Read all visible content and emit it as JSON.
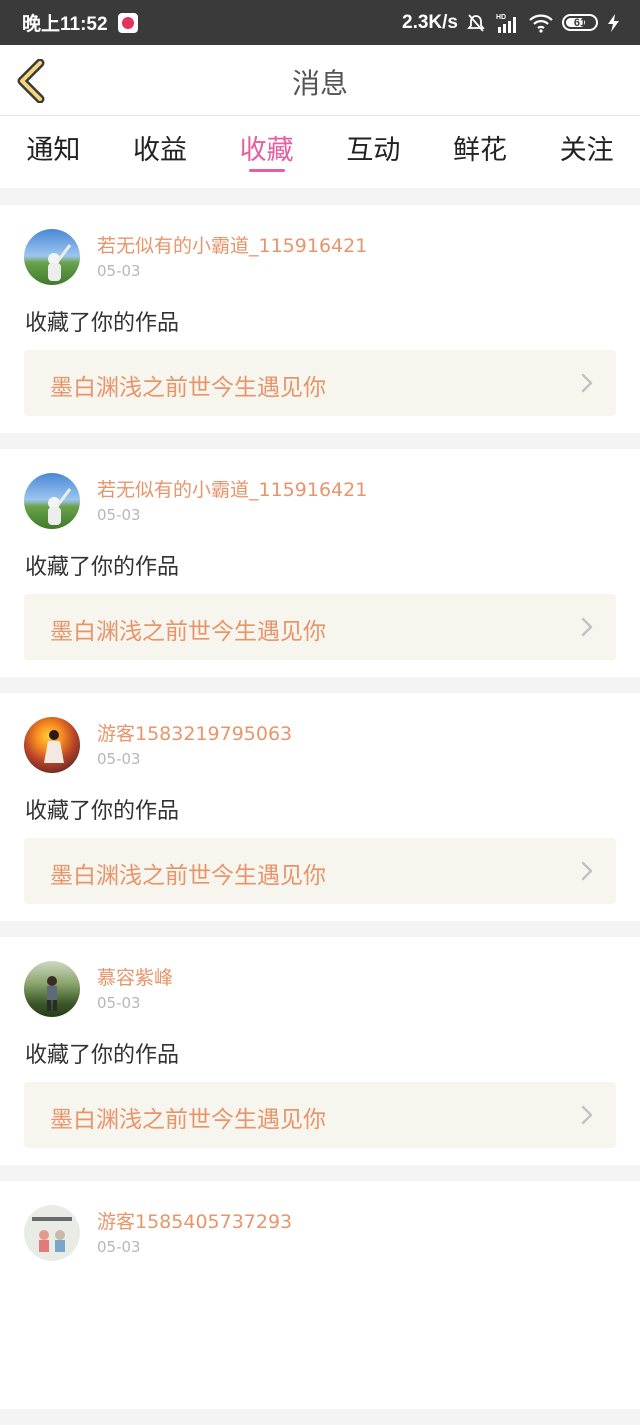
{
  "status": {
    "time": "晚上11:52",
    "speed": "2.3K/s",
    "hd": "HD",
    "battery": "61"
  },
  "header": {
    "title": "消息"
  },
  "tabs": [
    {
      "label": "通知"
    },
    {
      "label": "收益"
    },
    {
      "label": "收藏",
      "active": true
    },
    {
      "label": "互动"
    },
    {
      "label": "鲜花"
    },
    {
      "label": "关注"
    }
  ],
  "colors": {
    "accent": "#e5609e",
    "username": "#e8956b",
    "status_bar": "#3a3a3a"
  },
  "items": [
    {
      "user": "若无似有的小霸道_115916421",
      "date": "05-03",
      "action": "收藏了你的作品",
      "work": "墨白渊浅之前世今生遇见你"
    },
    {
      "user": "若无似有的小霸道_115916421",
      "date": "05-03",
      "action": "收藏了你的作品",
      "work": "墨白渊浅之前世今生遇见你"
    },
    {
      "user": "游客1583219795063",
      "date": "05-03",
      "action": "收藏了你的作品",
      "work": "墨白渊浅之前世今生遇见你"
    },
    {
      "user": "慕容紫峰",
      "date": "05-03",
      "action": "收藏了你的作品",
      "work": "墨白渊浅之前世今生遇见你"
    },
    {
      "user": "游客1585405737293",
      "date": "05-03"
    }
  ]
}
